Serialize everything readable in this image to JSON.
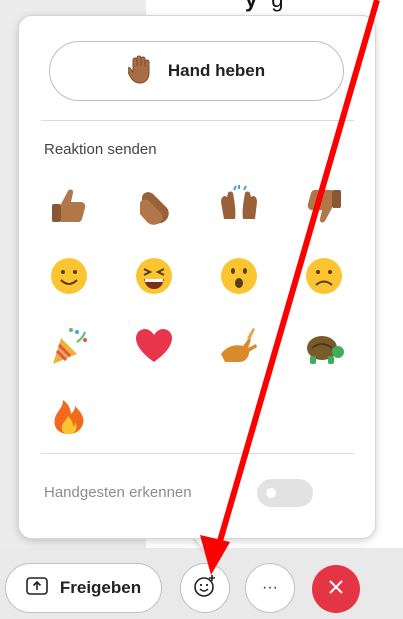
{
  "header": {
    "partial_text_1": "y",
    "partial_text_2": "g"
  },
  "popup": {
    "hand_button_label": "Hand heben",
    "reactions_title": "Reaktion senden",
    "reactions": [
      {
        "name": "thumbs-up"
      },
      {
        "name": "clapping-hands"
      },
      {
        "name": "raising-hands"
      },
      {
        "name": "thumbs-down"
      },
      {
        "name": "smiling-face"
      },
      {
        "name": "laughing-face"
      },
      {
        "name": "surprised-face"
      },
      {
        "name": "sad-face"
      },
      {
        "name": "party-popper"
      },
      {
        "name": "red-heart"
      },
      {
        "name": "running-rabbit"
      },
      {
        "name": "turtle"
      },
      {
        "name": "fire"
      }
    ],
    "gesture_toggle_label": "Handgesten erkennen",
    "gesture_toggle_on": false
  },
  "toolbar": {
    "share_label": "Freigeben",
    "emoji_icon": "emoji-plus-icon",
    "more_icon": "more-icon",
    "more_symbol": "···",
    "end_icon": "close-icon",
    "end_color": "#e43544"
  },
  "annotation": {
    "arrow_color": "#ff0000"
  }
}
